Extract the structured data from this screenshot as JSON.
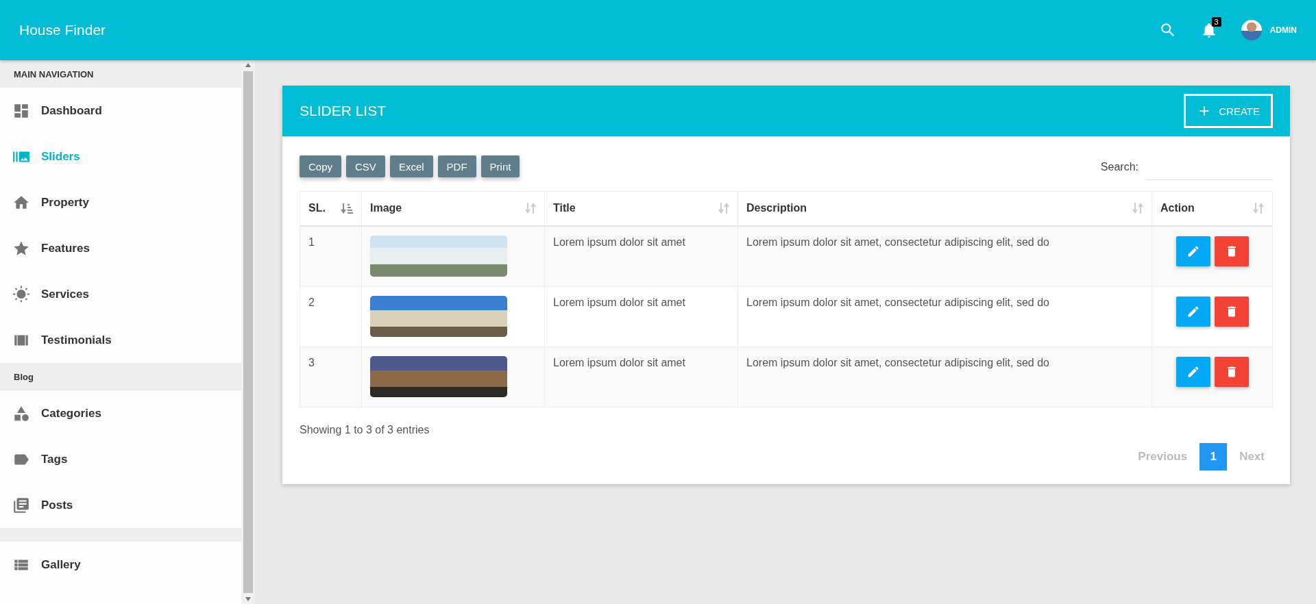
{
  "app_bar": {
    "title": "House Finder",
    "notifications": "3",
    "user": "ADMIN"
  },
  "sidebar": {
    "groups": [
      {
        "header": "MAIN NAVIGATION",
        "items": [
          {
            "label": "Dashboard",
            "selected": false
          },
          {
            "label": "Sliders",
            "selected": true
          },
          {
            "label": "Property",
            "selected": false
          },
          {
            "label": "Features",
            "selected": false
          },
          {
            "label": "Services",
            "selected": false
          },
          {
            "label": "Testimonials",
            "selected": false
          }
        ]
      },
      {
        "header": "Blog",
        "items": [
          {
            "label": "Categories",
            "selected": false
          },
          {
            "label": "Tags",
            "selected": false
          },
          {
            "label": "Posts",
            "selected": false
          }
        ]
      },
      {
        "items": [
          {
            "label": "Gallery",
            "selected": false
          }
        ]
      }
    ]
  },
  "card": {
    "title": "SLIDER LIST",
    "create_button": "CREATE",
    "export_buttons": [
      "Copy",
      "CSV",
      "Excel",
      "PDF",
      "Print"
    ],
    "search": {
      "label": "Search:"
    },
    "table": {
      "columns": [
        {
          "label": "SL.",
          "sorted": true
        },
        {
          "label": "Image",
          "sorted": false
        },
        {
          "label": "Title",
          "sorted": false
        },
        {
          "label": "Description",
          "sorted": false
        },
        {
          "label": "Action",
          "sorted": false
        }
      ],
      "rows": [
        {
          "sl": "1",
          "title": "Lorem ipsum dolor sit amet",
          "description": "Lorem ipsum dolor sit amet, consectetur adipiscing elit, sed do"
        },
        {
          "sl": "2",
          "title": "Lorem ipsum dolor sit amet",
          "description": "Lorem ipsum dolor sit amet, consectetur adipiscing elit, sed do"
        },
        {
          "sl": "3",
          "title": "Lorem ipsum dolor sit amet",
          "description": "Lorem ipsum dolor sit amet, consectetur adipiscing elit, sed do"
        }
      ]
    },
    "info": "Showing 1 to 3 of 3 entries",
    "pagination": {
      "previous": {
        "label": "Previous",
        "disabled": true
      },
      "pages": [
        {
          "label": "1",
          "selected": true
        }
      ],
      "next": {
        "label": "Next",
        "disabled": true
      }
    }
  }
}
